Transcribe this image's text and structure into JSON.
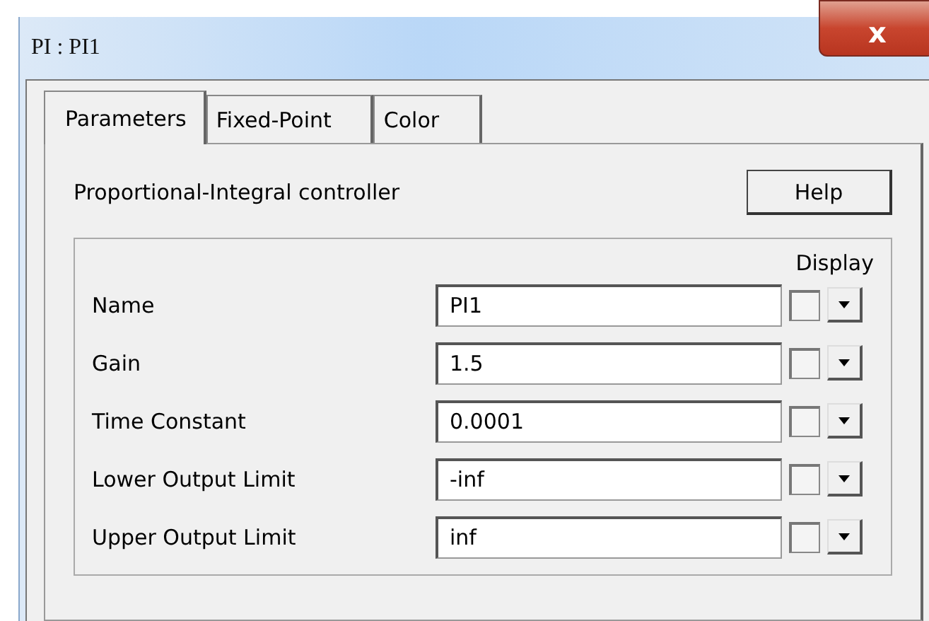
{
  "window": {
    "title": "PI : PI1",
    "close": "x"
  },
  "tabs": [
    {
      "label": "Parameters",
      "selected": true
    },
    {
      "label": "Fixed-Point",
      "selected": false
    },
    {
      "label": "Color",
      "selected": false
    }
  ],
  "description": "Proportional-Integral controller",
  "help_button": "Help",
  "display_header": "Display",
  "parameters": [
    {
      "label": "Name",
      "value": "PI1",
      "display": false
    },
    {
      "label": "Gain",
      "value": "1.5",
      "display": false
    },
    {
      "label": "Time Constant",
      "value": "0.0001",
      "display": false
    },
    {
      "label": "Lower Output Limit",
      "value": "-inf",
      "display": false
    },
    {
      "label": "Upper Output Limit",
      "value": "inf",
      "display": false
    }
  ]
}
